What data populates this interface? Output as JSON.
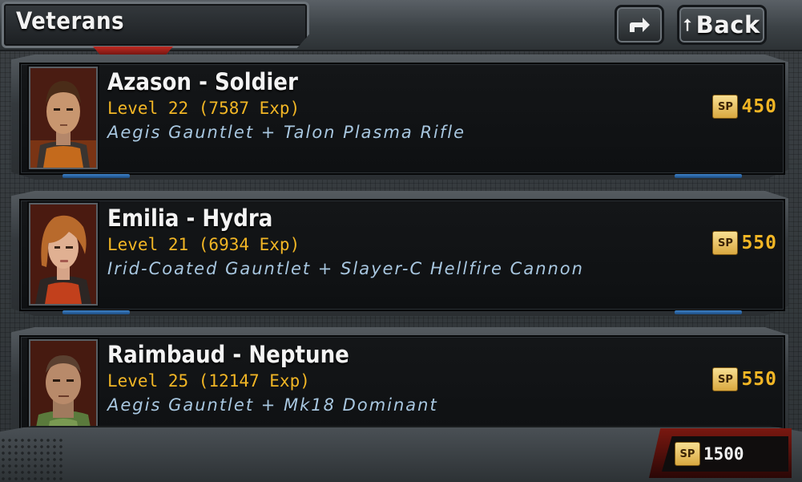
{
  "header": {
    "title": "Veterans",
    "share_icon": "share-arrow-icon",
    "back_label": "Back",
    "back_icon": "up-arrow-icon"
  },
  "veterans": [
    {
      "name": "Azason - Soldier",
      "level": "Level 22 (7587 Exp)",
      "loadout": "Aegis Gauntlet + Talon Plasma Rifle",
      "sp_badge": "SP",
      "sp": "450"
    },
    {
      "name": "Emilia - Hydra",
      "level": "Level 21 (6934 Exp)",
      "loadout": "Irid-Coated Gauntlet + Slayer-C Hellfire Cannon",
      "sp_badge": "SP",
      "sp": "550"
    },
    {
      "name": "Raimbaud - Neptune",
      "level": "Level 25 (12147 Exp)",
      "loadout": "Aegis Gauntlet + Mk18 Dominant",
      "sp_badge": "SP",
      "sp": "550"
    }
  ],
  "footer": {
    "sp_badge": "SP",
    "total_sp": "1500"
  },
  "colors": {
    "level_text": "#f2b625",
    "loadout_text": "#a8c7e0",
    "name_text": "#f4f4f4",
    "accent_red": "#c02a22",
    "accent_blue": "#3f83c9"
  }
}
